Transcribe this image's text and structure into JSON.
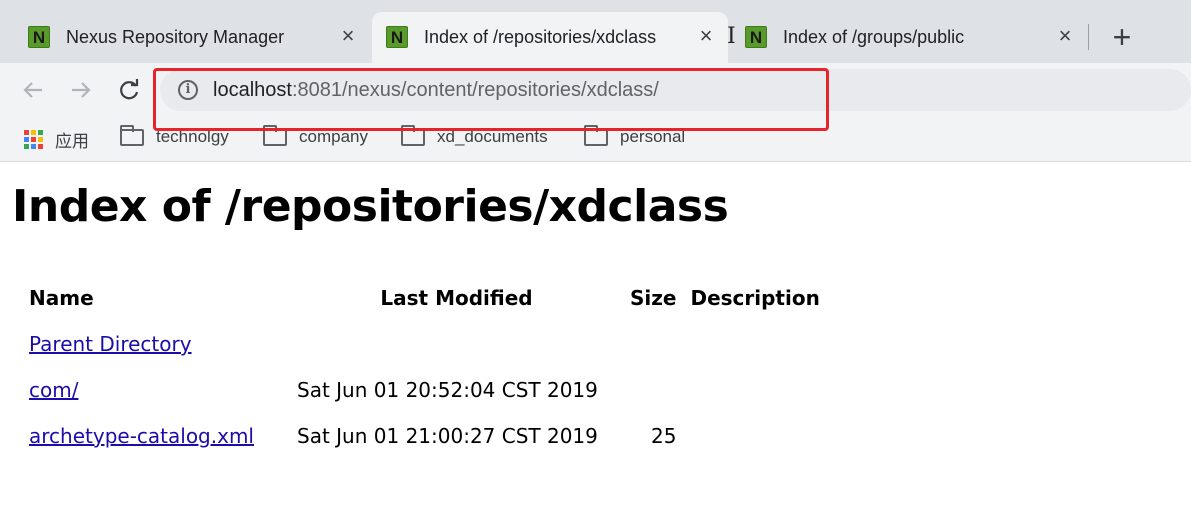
{
  "browser": {
    "tabs": [
      {
        "favicon": "N",
        "title": "Nexus Repository Manager",
        "active": false
      },
      {
        "favicon": "N",
        "title": "Index of /repositories/xdclass",
        "active": true
      },
      {
        "favicon": "N",
        "title": "Index of /groups/public",
        "active": false
      }
    ],
    "tab_close_glyph": "×",
    "new_tab_glyph": "+",
    "nav": {
      "back_icon": "arrow-left-icon",
      "forward_icon": "arrow-right-icon",
      "reload_icon": "reload-icon"
    },
    "address_bar": {
      "host": "localhost",
      "path": ":8081/nexus/content/repositories/xdclass/",
      "info_icon": "info-icon"
    },
    "bookmarks": [
      {
        "label": "应用",
        "icon": "apps-grid-icon"
      },
      {
        "label": "technolgy",
        "icon": "folder-icon"
      },
      {
        "label": "company",
        "icon": "folder-icon"
      },
      {
        "label": "xd_documents",
        "icon": "folder-icon"
      },
      {
        "label": "personal",
        "icon": "folder-icon"
      }
    ],
    "highlight_color": "#e5242b"
  },
  "page": {
    "title": "Index of /repositories/xdclass",
    "columns": [
      "Name",
      "Last Modified",
      "Size",
      "Description"
    ],
    "rows": [
      {
        "name": "Parent Directory",
        "modified": "",
        "size": "",
        "description": ""
      },
      {
        "name": "com/",
        "modified": "Sat Jun 01 20:52:04 CST 2019",
        "size": "",
        "description": ""
      },
      {
        "name": "archetype-catalog.xml",
        "modified": "Sat Jun 01 21:00:27 CST 2019",
        "size": "25",
        "description": ""
      }
    ],
    "link_color": "#1a0dab"
  }
}
